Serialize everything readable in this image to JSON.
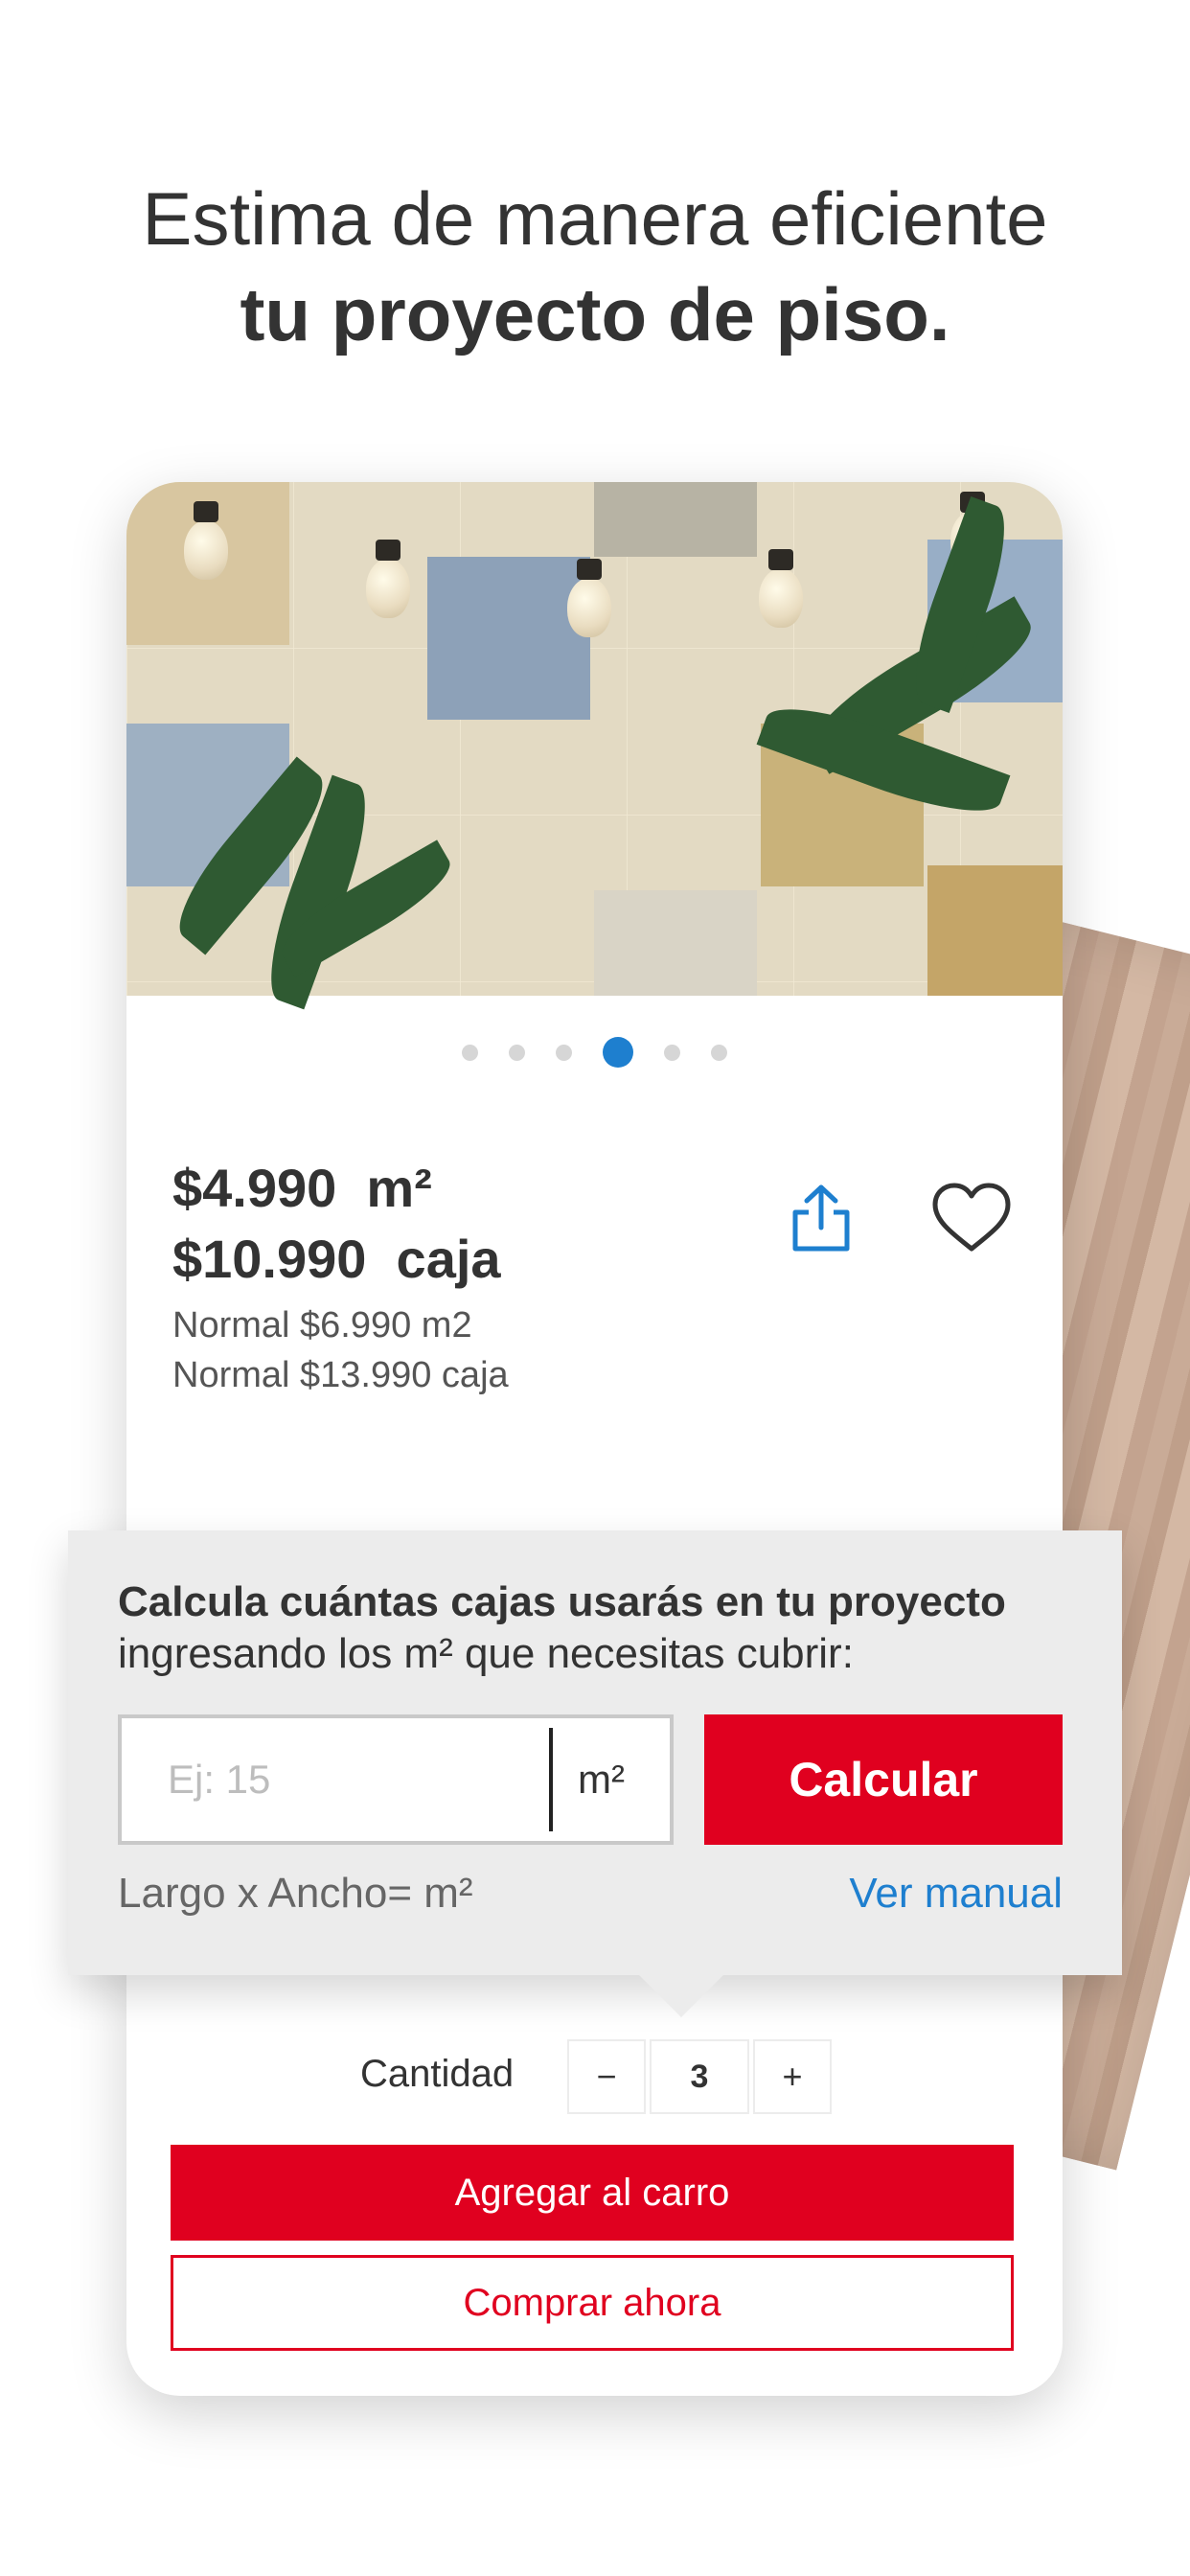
{
  "headline": {
    "line1": "Estima de manera eficiente",
    "line2": "tu proyecto de piso."
  },
  "carousel": {
    "count": 6,
    "active_index": 3
  },
  "product": {
    "price_m2": "$4.990  m²",
    "price_box": "$10.990  caja",
    "normal_m2": "Normal $6.990 m2",
    "normal_box": "Normal $13.990 caja",
    "share_icon": "share-icon",
    "favorite_icon": "heart-icon"
  },
  "calculator": {
    "title_bold": "Calcula cuántas cajas usarás en tu proyecto",
    "title_regular": "ingresando los m² que necesitas cubrir:",
    "input_placeholder": "Ej: 15",
    "input_value": "",
    "unit": "m²",
    "button": "Calcular",
    "hint": "Largo x Ancho= m²",
    "manual_link": "Ver manual"
  },
  "quantity": {
    "label": "Cantidad",
    "minus": "−",
    "value": "3",
    "plus": "+"
  },
  "actions": {
    "add_to_cart": "Agregar al carro",
    "buy_now": "Comprar ahora"
  },
  "colors": {
    "primary_red": "#e0001f",
    "link_blue": "#1e7fcf",
    "text_dark": "#333333"
  }
}
